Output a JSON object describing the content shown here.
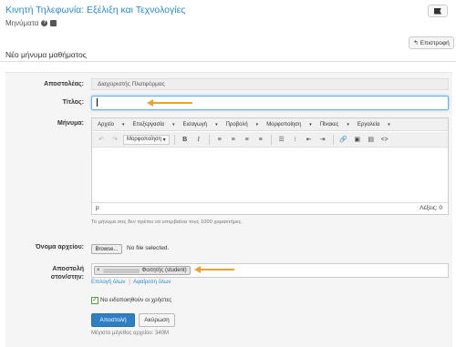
{
  "header": {
    "course_title": "Κινητή Τηλεφωνία: Εξέλιξη και Τεχνολογίες",
    "subtitle": "Μηνύματα"
  },
  "back_button": "Επιστροφή",
  "panel_title": "Νέο μήνυμα μαθήματος",
  "form": {
    "sender_label": "Αποστολέας:",
    "sender_value": "Διαχειριστής Πλατφόρμας",
    "title_label": "Τίτλος:",
    "title_value": "",
    "message_label": "Μήνυμα:",
    "editor_menus": [
      "Αρχείο",
      "Επεξεργασία",
      "Εισαγωγή",
      "Προβολή",
      "Μορφοποίηση",
      "Πίνακες",
      "Εργαλεία"
    ],
    "format_select": "Μορφοποίηση",
    "status_path": "p",
    "word_count": "Λέξεις: 0",
    "message_hint": "Το μήνυμα σας δεν πρέπει να υπερβαίνει τους 1000 χαρακτήρες.",
    "file_label": "Όνομα αρχείου:",
    "browse_label": "Browse...",
    "no_file": "No file selected.",
    "recipients_label_1": "Αποστολή",
    "recipients_label_2": "στον/στην:",
    "recipient_tag_remove": "×",
    "recipient_tag_suffix": "Φοιτητής (student)",
    "select_all": "Επιλογή όλων",
    "remove_all": "Αφαίρεση όλων",
    "notify_label": "Να ειδοποιηθούν οι χρήστες",
    "notify_checked": true,
    "send_button": "Αποστολή",
    "cancel_button": "Ακύρωση",
    "max_size": "Μέγιστο μέγεθος αρχείου: 340M"
  },
  "colors": {
    "accent": "#2f89c7",
    "primary_button": "#2f7fc4",
    "annotation_arrow": "#f0a030"
  }
}
